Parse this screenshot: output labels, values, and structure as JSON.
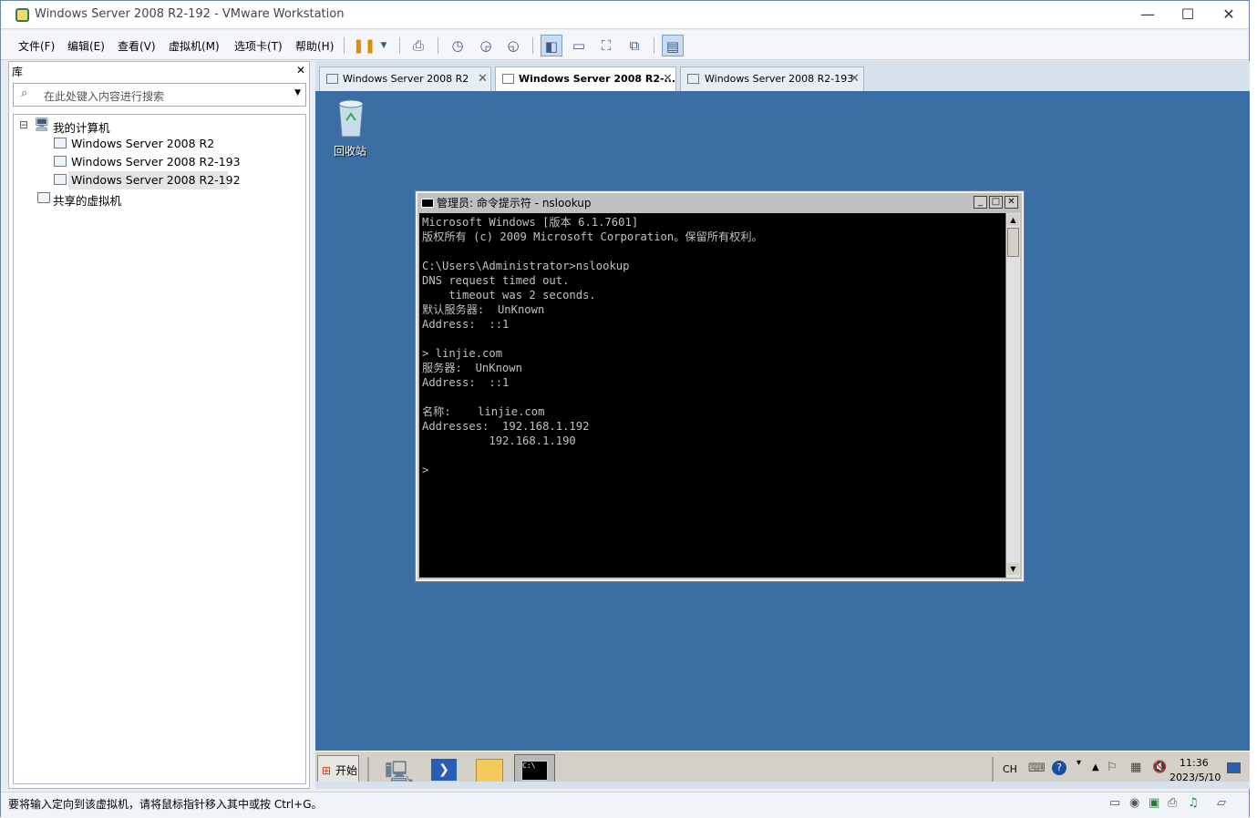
{
  "window": {
    "title": "Windows Server 2008 R2-192 - VMware Workstation",
    "controls": {
      "minimize": "—",
      "maximize": "☐",
      "close": "✕"
    }
  },
  "menu": [
    "文件(F)",
    "编辑(E)",
    "查看(V)",
    "虚拟机(M)",
    "选项卡(T)",
    "帮助(H)"
  ],
  "library": {
    "title": "库",
    "close": "✕",
    "search_placeholder": "在此处键入内容进行搜索",
    "tree": {
      "root": "我的计算机",
      "items": [
        "Windows Server 2008 R2",
        "Windows Server 2008 R2-193",
        "Windows Server 2008 R2-192"
      ],
      "shared": "共享的虚拟机",
      "expander": "⊟"
    }
  },
  "tabs": [
    {
      "label": "Windows Server 2008 R2",
      "active": false
    },
    {
      "label": "Windows Server 2008 R2-...",
      "active": true
    },
    {
      "label": "Windows Server 2008 R2-193",
      "active": false
    }
  ],
  "tab_close": "✕",
  "desktop": {
    "recycle_bin": "回收站"
  },
  "cmd": {
    "title": "管理员: 命令提示符 - nslookup",
    "lines": "Microsoft Windows [版本 6.1.7601]\n版权所有 (c) 2009 Microsoft Corporation。保留所有权利。\n\nC:\\Users\\Administrator>nslookup\nDNS request timed out.\n    timeout was 2 seconds.\n默认服务器:  UnKnown\nAddress:  ::1\n\n> linjie.com\n服务器:  UnKnown\nAddress:  ::1\n\n名称:    linjie.com\nAddresses:  192.168.1.192\n          192.168.1.190\n\n>",
    "btn_min": "_",
    "btn_max": "□",
    "btn_close": "✕"
  },
  "taskbar": {
    "start": "开始",
    "lang": "CH",
    "time": "11:36",
    "date": "2023/5/10"
  },
  "status": {
    "text": "要将输入定向到该虚拟机，请将鼠标指针移入其中或按 Ctrl+G。"
  }
}
